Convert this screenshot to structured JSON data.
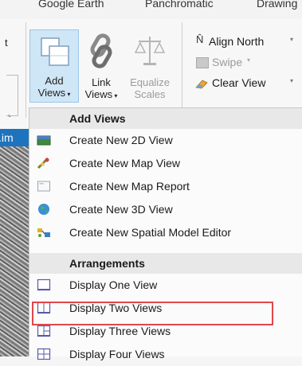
{
  "ribbon": {
    "tabs": [
      "Google Earth",
      "Panchromatic",
      "Drawing"
    ],
    "buttons": {
      "add_views": {
        "line1": "Add",
        "line2": "Views"
      },
      "link_views": {
        "line1": "Link",
        "line2": "Views"
      },
      "equalize_scales": {
        "line1": "Equalize",
        "line2": "Scales"
      },
      "align_north": "Align North",
      "swipe": "Swipe",
      "clear_view": "Clear View"
    },
    "cut_left_label": "t"
  },
  "map_title": ".im",
  "menu": {
    "sections": [
      {
        "header": "Add Views",
        "items": [
          {
            "label": "Create New 2D View",
            "icon": "2d-view-icon"
          },
          {
            "label": "Create New Map View",
            "icon": "map-view-icon"
          },
          {
            "label": "Create New Map Report",
            "icon": "map-report-icon"
          },
          {
            "label": "Create New 3D View",
            "icon": "globe-3d-icon"
          },
          {
            "label": "Create New Spatial Model Editor",
            "icon": "spatial-model-icon"
          }
        ]
      },
      {
        "header": "Arrangements",
        "items": [
          {
            "label": "Display One View",
            "icon": "one-view-icon"
          },
          {
            "label": "Display Two Views",
            "icon": "two-views-icon",
            "highlighted": true
          },
          {
            "label": "Display Three Views",
            "icon": "three-views-icon"
          },
          {
            "label": "Display Four Views",
            "icon": "four-views-icon"
          }
        ]
      }
    ]
  },
  "colors": {
    "accent": "#1e73be",
    "highlight_border": "#e0474c",
    "selected_button": "#cfe6f7"
  }
}
